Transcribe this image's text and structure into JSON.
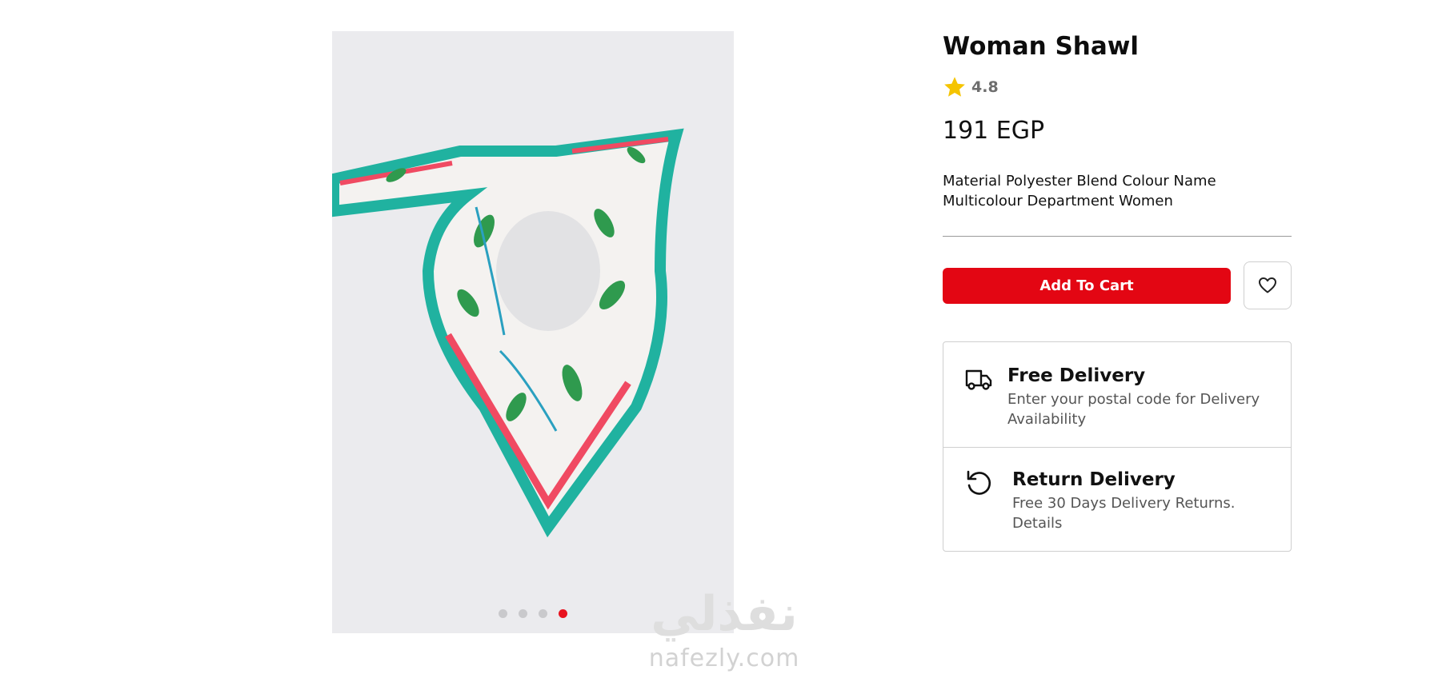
{
  "product": {
    "title": "Woman Shawl",
    "rating": "4.8",
    "price": "191 EGP",
    "description": "Material Polyester Blend Colour Name Multicolour Department Women"
  },
  "gallery": {
    "image_alt": "Woman Shawl",
    "slide_count": 4,
    "active_slide": 4
  },
  "actions": {
    "add_to_cart_label": "Add To Cart"
  },
  "delivery": {
    "free_title": "Free Delivery",
    "free_sub": "Enter your postal code for Delivery Availability",
    "return_title": "Return Delivery",
    "return_sub": "Free 30 Days Delivery Returns. Details"
  },
  "watermark": {
    "arabic": "نفذلي",
    "latin": "nafezly.com"
  },
  "icons": {
    "rating": "star-icon",
    "wishlist": "heart-icon",
    "free_delivery": "truck-icon",
    "return_delivery": "return-icon"
  },
  "colors": {
    "accent": "#e30613",
    "star": "#f5c400",
    "dot_active": "#e8131f"
  }
}
